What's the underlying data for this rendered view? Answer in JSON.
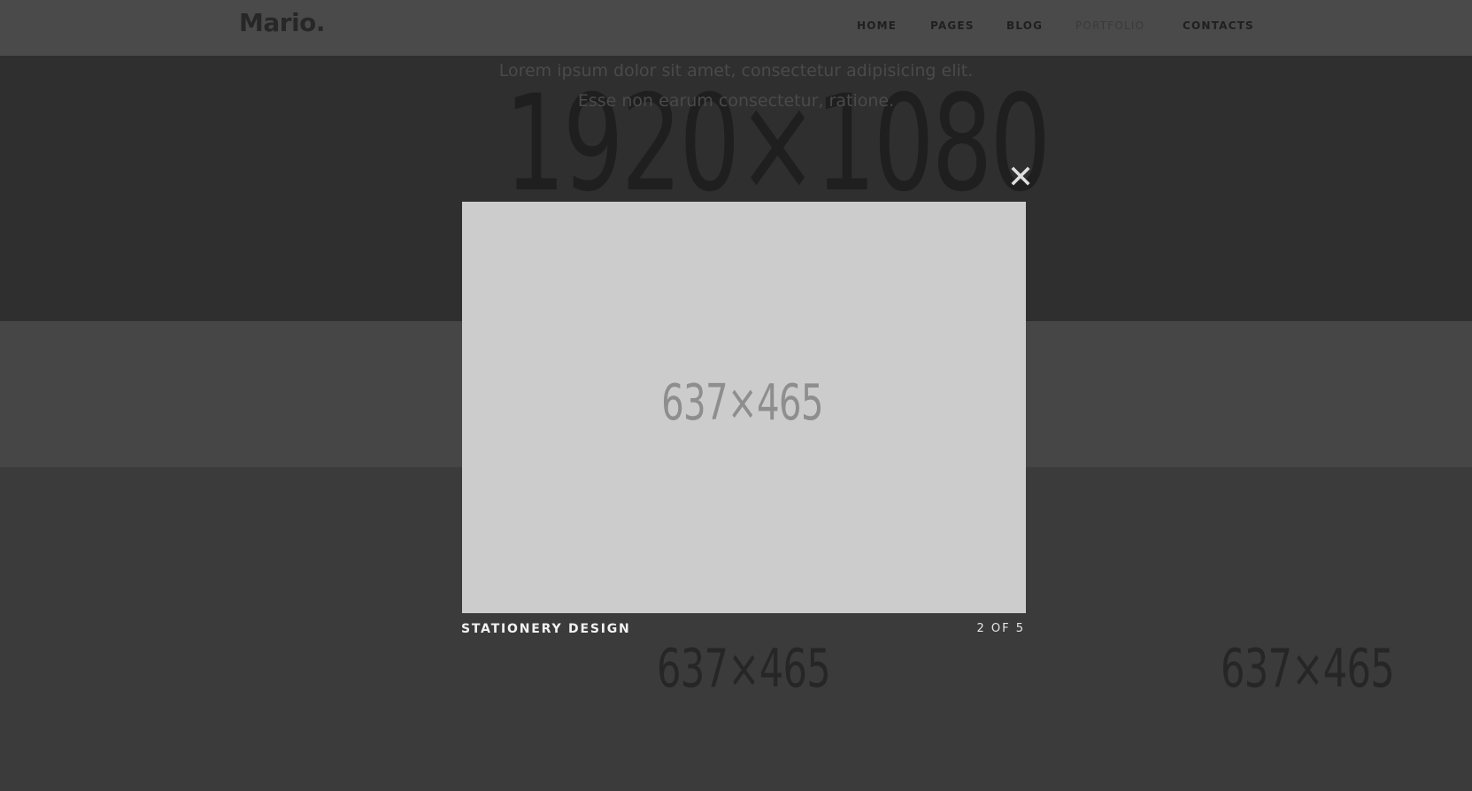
{
  "header": {
    "logo": "Mario.",
    "nav": [
      {
        "label": "HOME",
        "active": false
      },
      {
        "label": "PAGES",
        "active": false
      },
      {
        "label": "BLOG",
        "active": false
      },
      {
        "label": "PORTFOLIO",
        "active": true
      },
      {
        "label": "CONTACTS",
        "active": false
      }
    ]
  },
  "hero": {
    "watermark": "1920×1080",
    "line1": "Lorem ipsum dolor sit amet, consectetur adipisicing elit.",
    "line2": "Esse non earum consectetur, ratione."
  },
  "grid": {
    "placeholder_left": "637×465",
    "placeholder_right": "637×465"
  },
  "lightbox": {
    "image_label": "637×465",
    "title": "STATIONERY DESIGN",
    "counter": "2 OF 5",
    "close_icon": "close-icon"
  },
  "colors": {
    "overlay_bg": "#3b3b3b",
    "header_bg": "#4a4a4a",
    "hero_bg": "#2f2f2f",
    "image_bg": "#cccccc"
  }
}
